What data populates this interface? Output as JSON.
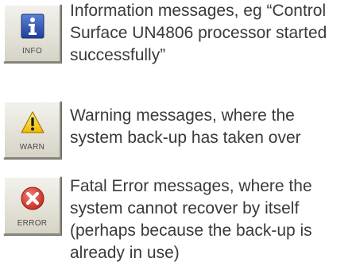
{
  "messages": [
    {
      "icon": "info-icon",
      "icon_caption": "INFO",
      "icon_color": "#2a4ea8",
      "text": "Information messages, eg “Control Surface UN4806 processor started successfully”"
    },
    {
      "icon": "warning-icon",
      "icon_caption": "WARN",
      "icon_color": "#f2c200",
      "text": "Warning messages, where the system back-up has taken over"
    },
    {
      "icon": "error-icon",
      "icon_caption": "ERROR",
      "icon_color": "#d23a2c",
      "text": "Fatal Error messages, where the system cannot recover by itself (perhaps because the back-up is already in use)"
    }
  ]
}
